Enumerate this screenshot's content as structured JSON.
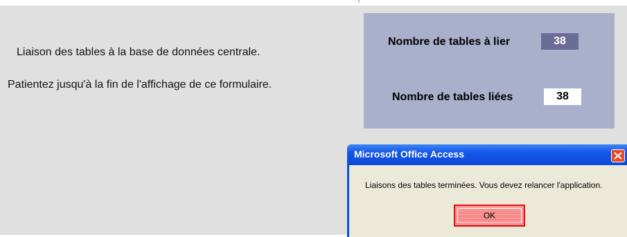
{
  "form": {
    "message_line1": "Liaison des tables à la base de données centrale.",
    "message_line2": "Patientez jusqu'à la fin de l'affichage de ce formulaire."
  },
  "counters": {
    "to_link_label": "Nombre de tables à lier",
    "to_link_value": "38",
    "linked_label": "Nombre de tables liées",
    "linked_value": "38"
  },
  "dialog": {
    "title": "Microsoft Office Access",
    "message": "Liaisons des tables terminées. Vous devez relancer l'application.",
    "ok_label": "OK",
    "close_icon": "close-icon"
  },
  "colors": {
    "panel": "#a9b0cb",
    "value_highlight": "#6a6c98",
    "titlebar": "#1556e6",
    "close": "#e34b2a"
  }
}
